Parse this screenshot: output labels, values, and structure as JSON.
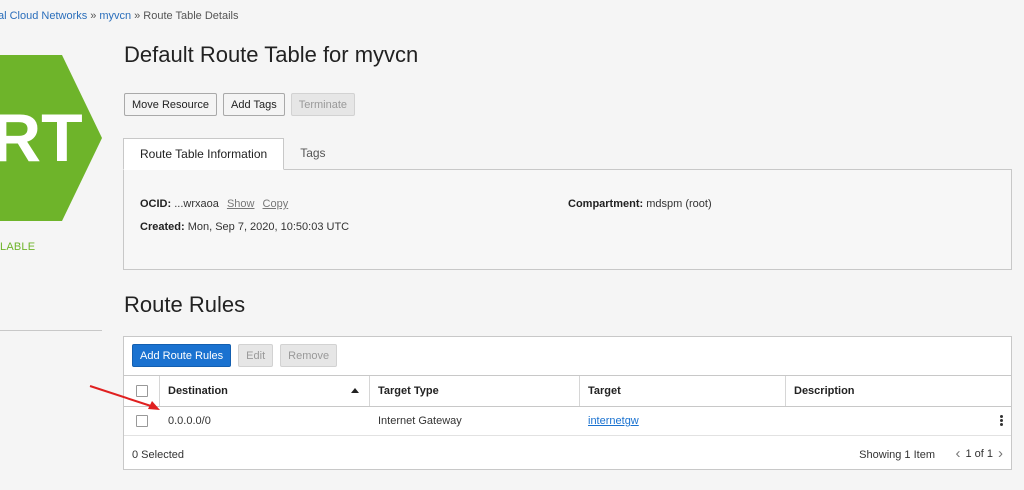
{
  "breadcrumb": {
    "items": [
      "al Cloud Networks",
      "myvcn",
      "Route Table Details"
    ],
    "separator": "»"
  },
  "resource_icon": {
    "letters": "RT",
    "color": "#6eb42a"
  },
  "status": {
    "text": "LABLE",
    "color": "#6eb42a"
  },
  "page_title": "Default Route Table for myvcn",
  "actions": {
    "move": "Move Resource",
    "add_tags": "Add Tags",
    "terminate": "Terminate"
  },
  "tabs": [
    {
      "label": "Route Table Information",
      "active": true
    },
    {
      "label": "Tags",
      "active": false
    }
  ],
  "info": {
    "ocid_label": "OCID:",
    "ocid_value": "...wrxaoa",
    "ocid_show": "Show",
    "ocid_copy": "Copy",
    "created_label": "Created:",
    "created_value": "Mon, Sep 7, 2020, 10:50:03 UTC",
    "compartment_label": "Compartment:",
    "compartment_value": "mdspm (root)"
  },
  "route_rules": {
    "title": "Route Rules",
    "buttons": {
      "add": "Add Route Rules",
      "edit": "Edit",
      "remove": "Remove"
    },
    "columns": [
      "Destination",
      "Target Type",
      "Target",
      "Description"
    ],
    "rows": [
      {
        "destination": "0.0.0.0/0",
        "target_type": "Internet Gateway",
        "target": "internetgw",
        "description": ""
      }
    ],
    "footer": {
      "selected": "0 Selected",
      "showing": "Showing 1 Item",
      "page": "1 of 1"
    }
  },
  "colors": {
    "accent": "#1a72d0",
    "brand_green": "#6eb42a",
    "annotation_arrow": "#e02020"
  }
}
